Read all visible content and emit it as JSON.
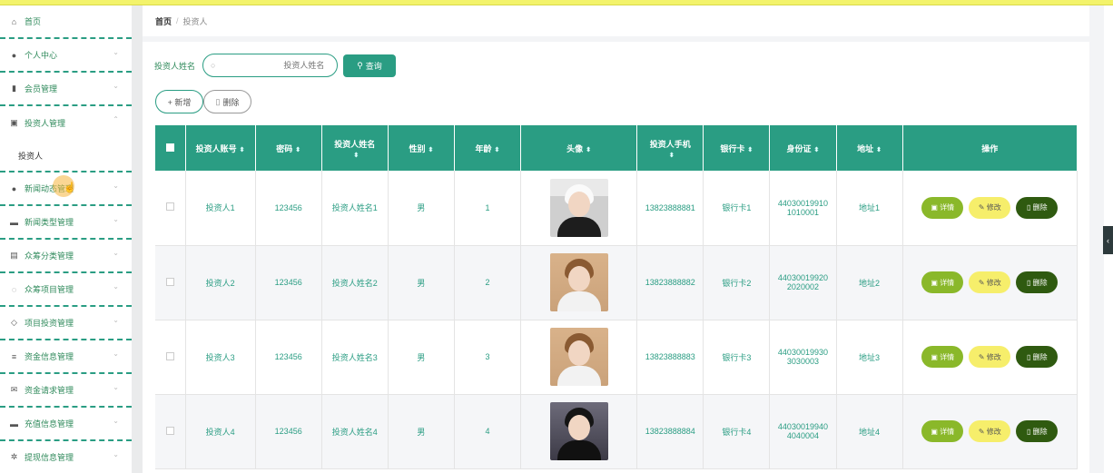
{
  "sidebar": {
    "items": [
      {
        "label": "首页",
        "icon": "home-icon",
        "glyph": "⌂",
        "chevron": false
      },
      {
        "label": "个人中心",
        "icon": "user-icon",
        "glyph": "●",
        "chevron": true
      },
      {
        "label": "会员管理",
        "icon": "chart-icon",
        "glyph": "▮",
        "chevron": true
      },
      {
        "label": "投资人管理",
        "icon": "form-icon",
        "glyph": "▣",
        "chevron": true,
        "expanded": true
      },
      {
        "label": "新闻动态管理",
        "icon": "user-icon",
        "glyph": "●",
        "chevron": true
      },
      {
        "label": "新闻类型管理",
        "icon": "chat-icon",
        "glyph": "▬",
        "chevron": true
      },
      {
        "label": "众筹分类管理",
        "icon": "clipboard-icon",
        "glyph": "▤",
        "chevron": true
      },
      {
        "label": "众筹项目管理",
        "icon": "power-icon",
        "glyph": "◌",
        "chevron": true
      },
      {
        "label": "项目投资管理",
        "icon": "bell-off-icon",
        "glyph": "◇",
        "chevron": true
      },
      {
        "label": "资金信息管理",
        "icon": "list-icon",
        "glyph": "≡",
        "chevron": true
      },
      {
        "label": "资金请求管理",
        "icon": "mail-icon",
        "glyph": "✉",
        "chevron": true
      },
      {
        "label": "充值信息管理",
        "icon": "bag-icon",
        "glyph": "▬",
        "chevron": true
      },
      {
        "label": "提现信息管理",
        "icon": "settings-icon",
        "glyph": "✲",
        "chevron": true
      }
    ],
    "subitem": "投资人"
  },
  "breadcrumb": {
    "home": "首页",
    "sep": "/",
    "current": "投资人"
  },
  "search": {
    "label": "投资人姓名",
    "placeholder": "投资人姓名",
    "button": "查询"
  },
  "actions": {
    "add": "+ 新增",
    "delete": "删除"
  },
  "table": {
    "headers": {
      "account": "投资人账号",
      "password": "密码",
      "name": "投资人姓名",
      "gender": "性别",
      "age": "年龄",
      "avatar": "头像",
      "phone": "投资人手机",
      "bank": "银行卡",
      "idcard": "身份证",
      "address": "地址",
      "ops": "操作"
    },
    "rows": [
      {
        "account": "投资人1",
        "password": "123456",
        "name": "投资人姓名1",
        "gender": "男",
        "age": "1",
        "phone": "13823888881",
        "bank": "银行卡1",
        "id1": "44030019910",
        "id2": "1010001",
        "address": "地址1"
      },
      {
        "account": "投资人2",
        "password": "123456",
        "name": "投资人姓名2",
        "gender": "男",
        "age": "2",
        "phone": "13823888882",
        "bank": "银行卡2",
        "id1": "44030019920",
        "id2": "2020002",
        "address": "地址2"
      },
      {
        "account": "投资人3",
        "password": "123456",
        "name": "投资人姓名3",
        "gender": "男",
        "age": "3",
        "phone": "13823888883",
        "bank": "银行卡3",
        "id1": "44030019930",
        "id2": "3030003",
        "address": "地址3"
      },
      {
        "account": "投资人4",
        "password": "123456",
        "name": "投资人姓名4",
        "gender": "男",
        "age": "4",
        "phone": "13823888884",
        "bank": "银行卡4",
        "id1": "44030019940",
        "id2": "4040004",
        "address": "地址4"
      }
    ],
    "ops": {
      "detail": "详情",
      "edit": "修改",
      "delete": "删除"
    }
  },
  "colors": {
    "accent": "#2a9d83",
    "detail": "#8ab82a",
    "edit": "#f6ee6b",
    "delete": "#2f5a10",
    "topbar": "#f3f36b"
  }
}
